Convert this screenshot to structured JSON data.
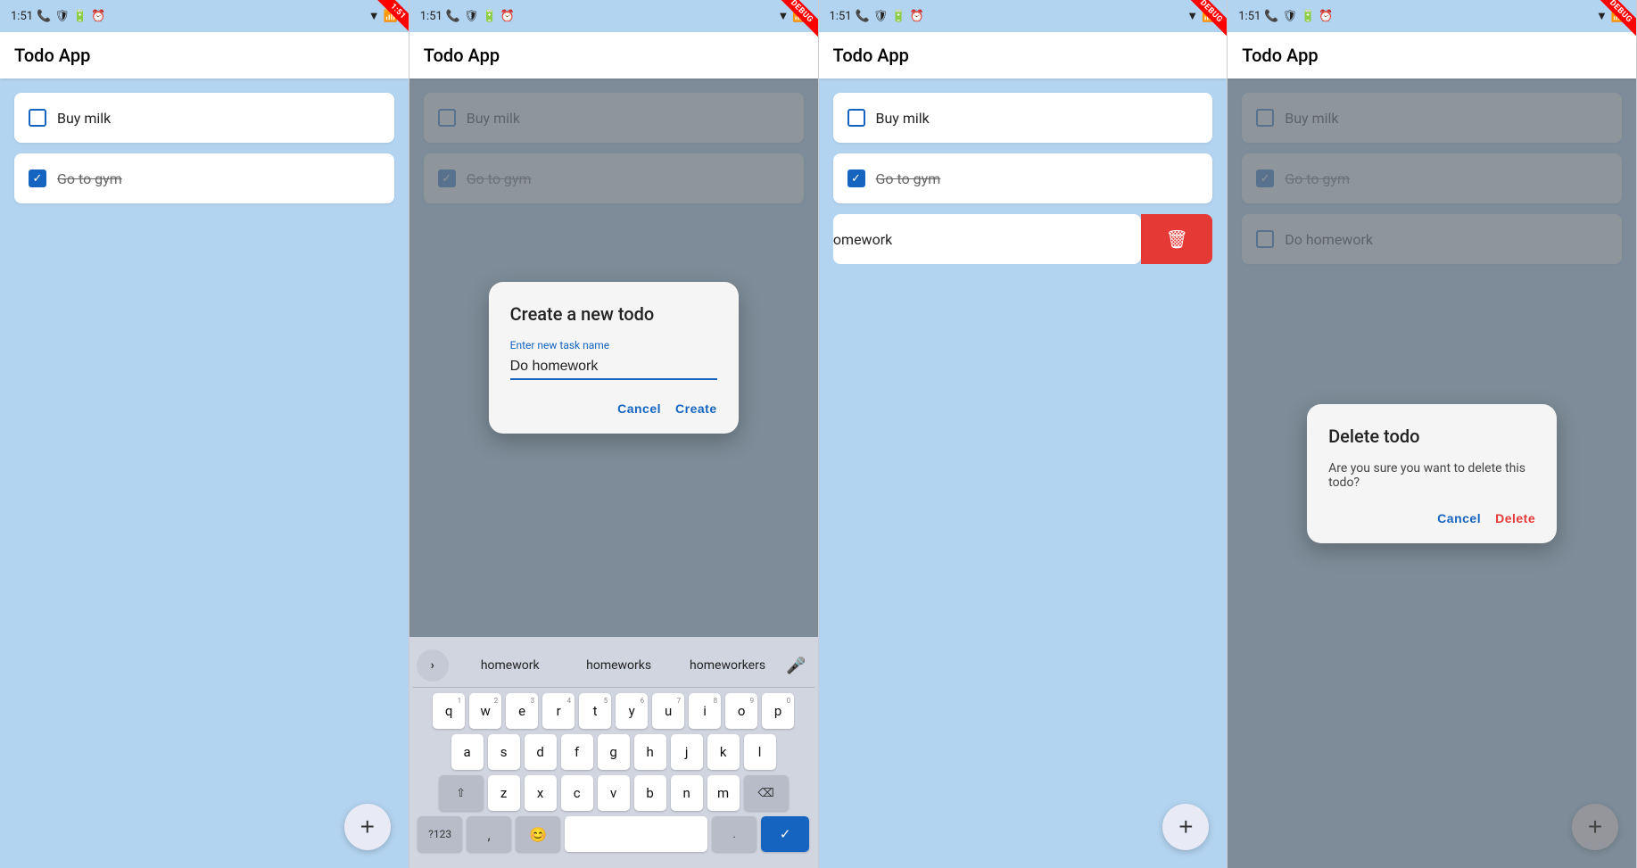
{
  "panels": [
    {
      "id": "panel-1",
      "status": {
        "time": "1:51",
        "icons_left": [
          "phone",
          "shield",
          "battery",
          "clock"
        ],
        "icons_right": [
          "wifi",
          "signal"
        ]
      },
      "appTitle": "Todo App",
      "todos": [
        {
          "id": "t1",
          "text": "Buy milk",
          "checked": false
        },
        {
          "id": "t2",
          "text": "Go to gym",
          "checked": true
        }
      ],
      "fab": "+",
      "overlay": null
    },
    {
      "id": "panel-2",
      "status": {
        "time": "1:51",
        "icons_left": [
          "phone",
          "shield",
          "battery",
          "clock"
        ],
        "icons_right": [
          "wifi",
          "signal"
        ]
      },
      "appTitle": "Todo App",
      "todos": [
        {
          "id": "t1",
          "text": "Buy milk",
          "checked": false
        },
        {
          "id": "t2",
          "text": "Go to gym",
          "checked": true
        }
      ],
      "fab": "+",
      "overlay": "create-dialog",
      "dialog": {
        "title": "Create a new todo",
        "inputLabel": "Enter new task name",
        "inputValue": "Do homework",
        "cancelLabel": "Cancel",
        "confirmLabel": "Create"
      },
      "keyboard": {
        "suggestions": [
          "homework",
          "homeworks",
          "homeworkers"
        ],
        "rows": [
          [
            "q",
            "w",
            "e",
            "r",
            "t",
            "y",
            "u",
            "i",
            "o",
            "p"
          ],
          [
            "a",
            "s",
            "d",
            "f",
            "g",
            "h",
            "j",
            "k",
            "l"
          ],
          [
            "z",
            "x",
            "c",
            "v",
            "b",
            "n",
            "m"
          ]
        ],
        "superscripts": [
          "1",
          "2",
          "3",
          "4",
          "5",
          "6",
          "7",
          "8",
          "9",
          "0"
        ]
      }
    },
    {
      "id": "panel-3",
      "status": {
        "time": "1:51",
        "icons_left": [
          "phone",
          "shield",
          "battery",
          "clock"
        ],
        "icons_right": [
          "wifi",
          "signal"
        ]
      },
      "appTitle": "Todo App",
      "todos": [
        {
          "id": "t1",
          "text": "Buy milk",
          "checked": false
        },
        {
          "id": "t2",
          "text": "Go to gym",
          "checked": true
        }
      ],
      "fab": "+",
      "swipedItem": {
        "text": "Do homework",
        "checked": false
      },
      "overlay": null
    },
    {
      "id": "panel-4",
      "status": {
        "time": "1:51",
        "icons_left": [
          "phone",
          "shield",
          "battery",
          "clock"
        ],
        "icons_right": [
          "wifi",
          "signal"
        ]
      },
      "appTitle": "Todo App",
      "todos": [
        {
          "id": "t1",
          "text": "Buy milk",
          "checked": false
        },
        {
          "id": "t2",
          "text": "Go to gym",
          "checked": true
        },
        {
          "id": "t3",
          "text": "Do homework",
          "checked": false
        }
      ],
      "fab": "+",
      "overlay": "delete-dialog",
      "dialog": {
        "title": "Delete todo",
        "bodyText": "Are you sure you want to delete this todo?",
        "cancelLabel": "Cancel",
        "confirmLabel": "Delete"
      }
    }
  ],
  "colors": {
    "accent": "#1565c0",
    "delete": "#e53935",
    "background": "#b3d4f0",
    "appBar": "#ffffff",
    "card": "#ffffff",
    "overlay": "rgba(80,80,80,0.55)"
  }
}
